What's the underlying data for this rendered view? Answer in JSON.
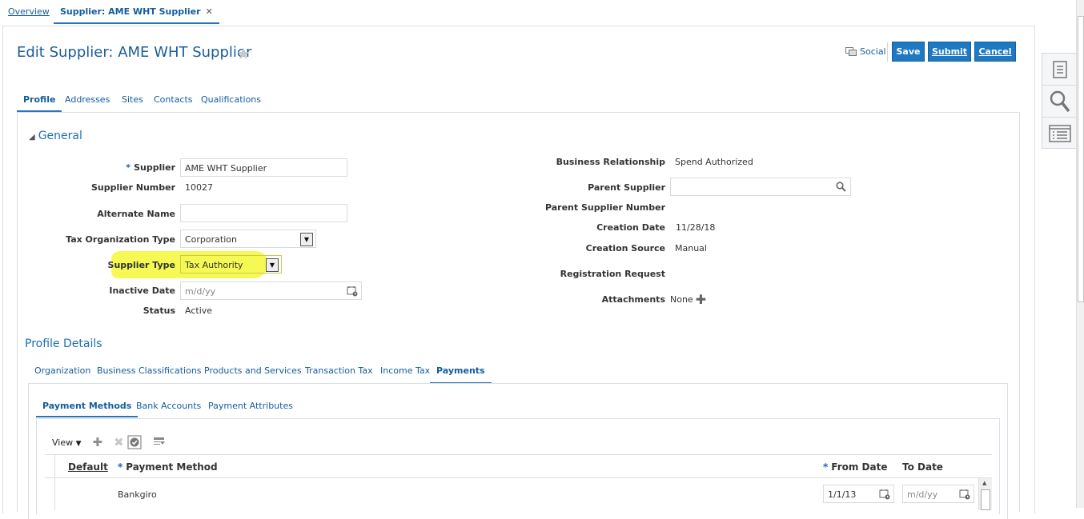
{
  "top_tabs": {
    "overview": "Overview",
    "supplier": "Supplier: AME WHT Supplier",
    "close": "✕"
  },
  "header": {
    "title": "Edit Supplier: AME WHT Supplier",
    "social": "Social",
    "save": "Save",
    "submit": "Submit",
    "cancel": "Cancel"
  },
  "subtabs": [
    "Profile",
    "Addresses",
    "Sites",
    "Contacts",
    "Qualifications"
  ],
  "general": {
    "heading": "General",
    "supplier_label": "Supplier",
    "supplier_value": "AME WHT Supplier",
    "supplier_number_label": "Supplier Number",
    "supplier_number_value": "10027",
    "alternate_name_label": "Alternate Name",
    "alternate_name_value": "",
    "tax_org_type_label": "Tax Organization Type",
    "tax_org_type_value": "Corporation",
    "supplier_type_label": "Supplier Type",
    "supplier_type_value": "Tax Authority",
    "inactive_date_label": "Inactive Date",
    "inactive_date_placeholder": "m/d/yy",
    "status_label": "Status",
    "status_value": "Active",
    "business_relationship_label": "Business Relationship",
    "business_relationship_value": "Spend Authorized",
    "parent_supplier_label": "Parent Supplier",
    "parent_supplier_number_label": "Parent Supplier Number",
    "creation_date_label": "Creation Date",
    "creation_date_value": "11/28/18",
    "creation_source_label": "Creation Source",
    "creation_source_value": "Manual",
    "registration_request_label": "Registration Request",
    "attachments_label": "Attachments",
    "attachments_value": "None"
  },
  "profile_details": {
    "heading": "Profile Details",
    "tabs": [
      "Organization",
      "Business Classifications",
      "Products and Services",
      "Transaction Tax",
      "Income Tax",
      "Payments"
    ]
  },
  "payments": {
    "tabs": [
      "Payment Methods",
      "Bank Accounts",
      "Payment Attributes"
    ],
    "view_label": "View",
    "columns": {
      "default": "Default",
      "payment_method": "Payment Method",
      "from_date": "From Date",
      "to_date": "To Date"
    },
    "rows": [
      {
        "payment_method": "Bankgiro",
        "from_date": "1/1/13",
        "to_date_placeholder": "m/d/yy"
      }
    ]
  },
  "colors": {
    "accent": "#1e78c2",
    "link": "#145c9e",
    "highlight": "#f6f94a"
  }
}
